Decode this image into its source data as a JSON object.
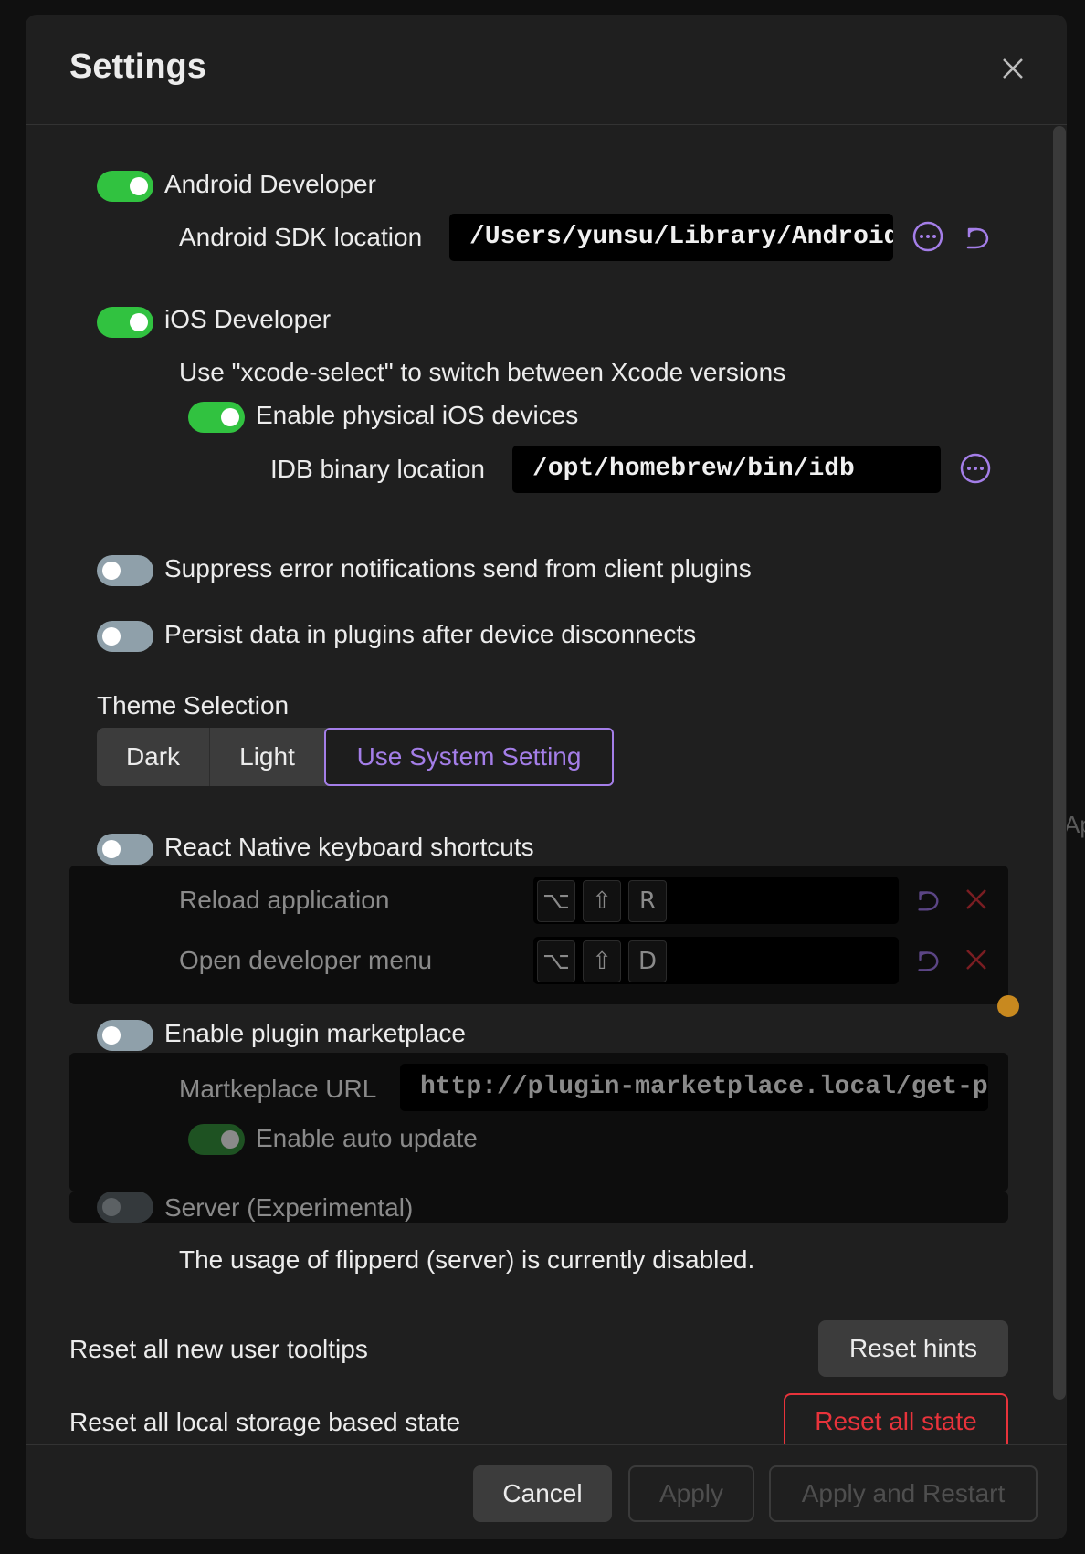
{
  "dialog": {
    "title": "Settings"
  },
  "android": {
    "toggle_label": "Android Developer",
    "sdk_label": "Android SDK location",
    "sdk_value": "/Users/yunsu/Library/Android/sdk"
  },
  "ios": {
    "toggle_label": "iOS Developer",
    "xcode_note": "Use \"xcode-select\" to switch between Xcode versions",
    "physical_label": "Enable physical iOS devices",
    "idb_label": "IDB binary location",
    "idb_value": "/opt/homebrew/bin/idb"
  },
  "suppress": {
    "label": "Suppress error notifications send from client plugins"
  },
  "persist": {
    "label": "Persist data in plugins after device disconnects"
  },
  "theme": {
    "heading": "Theme Selection",
    "options": [
      "Dark",
      "Light",
      "Use System Setting"
    ],
    "selected": "Use System Setting"
  },
  "rn": {
    "toggle_label": "React Native keyboard shortcuts",
    "shortcuts": [
      {
        "label": "Reload application",
        "keys": [
          "⌥",
          "⇧",
          "R"
        ]
      },
      {
        "label": "Open developer menu",
        "keys": [
          "⌥",
          "⇧",
          "D"
        ]
      }
    ]
  },
  "marketplace": {
    "toggle_label": "Enable plugin marketplace",
    "url_label": "Martkeplace URL",
    "url_value": "http://plugin-marketplace.local/get-plugins",
    "auto_update_label": "Enable auto update"
  },
  "server": {
    "toggle_label": "Server (Experimental)",
    "note": "The usage of flipperd (server) is currently disabled."
  },
  "reset": {
    "tooltips_label": "Reset all new user tooltips",
    "hints_button": "Reset hints",
    "state_label": "Reset all local storage based state",
    "state_button": "Reset all state"
  },
  "footer": {
    "cancel": "Cancel",
    "apply": "Apply",
    "apply_restart": "Apply and Restart"
  },
  "edge_text": "Ap",
  "colors": {
    "accent": "#a47ee8",
    "switch_on": "#31c240",
    "danger": "#e8333b",
    "warning_dot": "#c8891f"
  }
}
